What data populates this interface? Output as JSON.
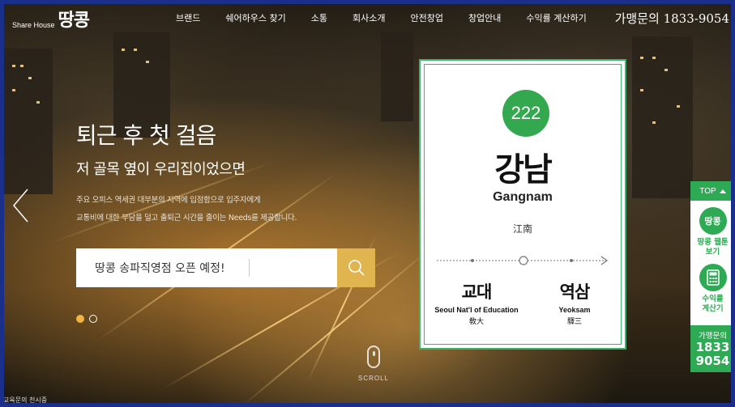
{
  "header": {
    "logo_small": "Share House",
    "logo_big": "땅콩",
    "nav": [
      "브랜드",
      "쉐어하우스 찾기",
      "소통",
      "회사소개",
      "안전창업",
      "창업안내",
      "수익률 계산하기"
    ],
    "phone": "가맹문의 1833-9054"
  },
  "hero": {
    "title": "퇴근 후 첫 걸음",
    "subtitle": "저 골목 옆이 우리집이었으면",
    "desc_line1": "주요 오피스 역세권 대부분의 지역에 입점함으로 입주자에게",
    "desc_line2": "교통비에 대한 부담을 덜고 출퇴근 시간을 줄이는 Needs를 제공합니다."
  },
  "search": {
    "text": "땅콩 송파직영점 오픈 예정!"
  },
  "slider": {
    "dots": 2,
    "active_index": 0
  },
  "station": {
    "number": "222",
    "name_ko": "강남",
    "name_en": "Gangnam",
    "name_hanja": "江南",
    "prev": {
      "ko": "교대",
      "en": "Seoul Nat'l of Education",
      "hanja": "敎大"
    },
    "next": {
      "ko": "역삼",
      "en": "Yeoksam",
      "hanja": "驛三"
    },
    "line_color": "#33a84f"
  },
  "scroll": {
    "label": "SCROLL"
  },
  "quick_menu": {
    "top_label": "TOP",
    "webtoon_icon": "땅콩",
    "webtoon_label_1": "땅콩 웹툰",
    "webtoon_label_2": "보기",
    "calc_label_1": "수익률",
    "calc_label_2": "계산기",
    "call_label": "가맹문의",
    "call_num_1": "1833",
    "call_num_2": "9054"
  },
  "footer_corner": "교육문의 천시중",
  "colors": {
    "accent_green": "#2eaa55",
    "search_gold": "#e0b44f",
    "frame_blue": "#1a2f8a"
  }
}
